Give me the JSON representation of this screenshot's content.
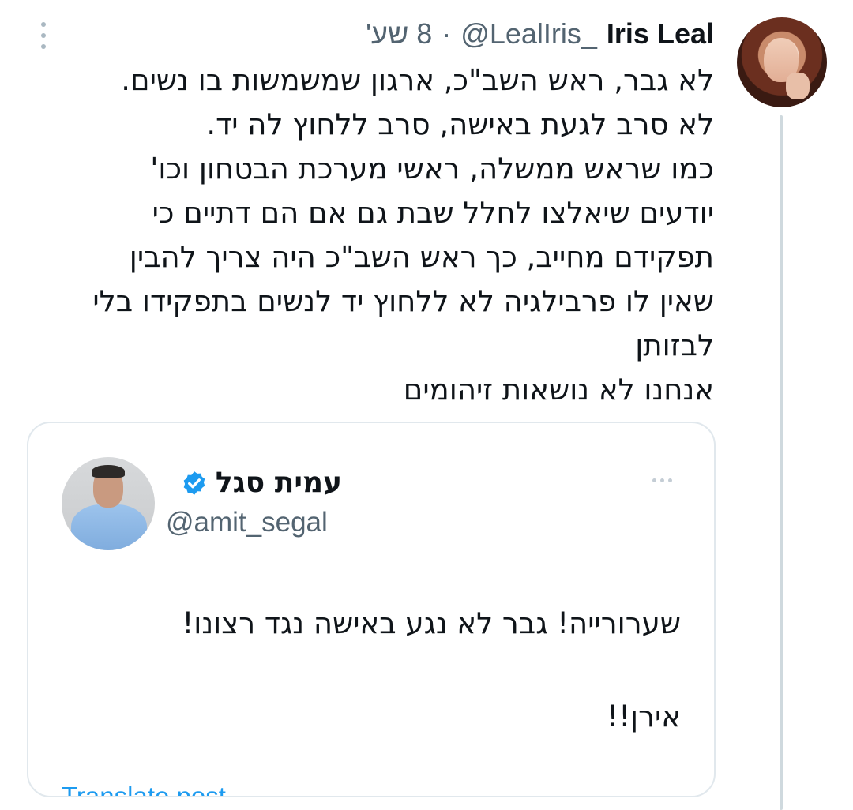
{
  "tweet": {
    "author_name": "Iris Leal",
    "author_handle": "@LealIris_",
    "separator": "·",
    "time": "8 שע'",
    "text_lines": [
      "לא גבר, ראש השב\"כ, ארגון שמשמשות בו נשים.",
      "לא סרב לגעת באישה, סרב ללחוץ לה יד.",
      "כמו שראש ממשלה, ראשי מערכת הבטחון וכו'",
      "יודעים שיאלצו לחלל שבת גם אם הם דתיים כי",
      "תפקידם מחייב, כך ראש השב\"כ היה צריך להבין",
      "שאין לו פרבילגיה לא ללחוץ יד לנשים בתפקידו בלי",
      "לבזותן",
      "אנחנו לא נושאות זיהומים"
    ]
  },
  "quoted": {
    "author_name": "עמית סגל",
    "author_handle": "@amit_segal",
    "verified": true,
    "text_lines": [
      "שערורייה! גבר לא נגע באישה נגד רצונו!",
      "אירן!!"
    ],
    "translate_label": "Translate post"
  },
  "icons": {
    "more": "more-vertical-icon",
    "quote_more": "more-horizontal-icon",
    "verified": "verified-badge-icon"
  },
  "colors": {
    "text": "#0f1419",
    "secondary": "#536471",
    "link": "#1d9bf0",
    "verified": "#1d9bf0",
    "border": "#e1e8ed",
    "thread_line": "#cfd9de"
  }
}
